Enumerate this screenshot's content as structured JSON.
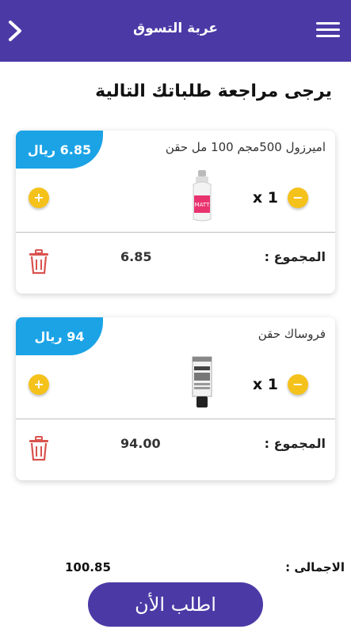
{
  "header": {
    "title": "عربة التسوق",
    "back_icon": "chevron-right-icon",
    "menu_icon": "hamburger-menu-icon",
    "bg_color": "#4b3aa6"
  },
  "page_heading": "يرجى مراجعة طلباتك التالية",
  "items": [
    {
      "name": "اميرزول 500مجم 100 مل حقن",
      "price": "6.85 ريال",
      "quantity": "x 1",
      "total_label": "المجموع :",
      "total_value": "6.85",
      "image": "spray-bottle-product-image"
    },
    {
      "name": "فروساك حقن",
      "price": "94 ريال",
      "quantity": "x 1",
      "total_label": "المجموع :",
      "total_value": "94.00",
      "image": "tube-product-image"
    }
  ],
  "summary": {
    "grand_total_label": "الاجمالى :",
    "grand_total_value": "100.85"
  },
  "order_button_label": "اطلب الأن",
  "colors": {
    "accent": "#4b3aa6",
    "price_tag": "#1ba3e6",
    "stepper": "#f5c21b",
    "trash": "#d9534f"
  }
}
